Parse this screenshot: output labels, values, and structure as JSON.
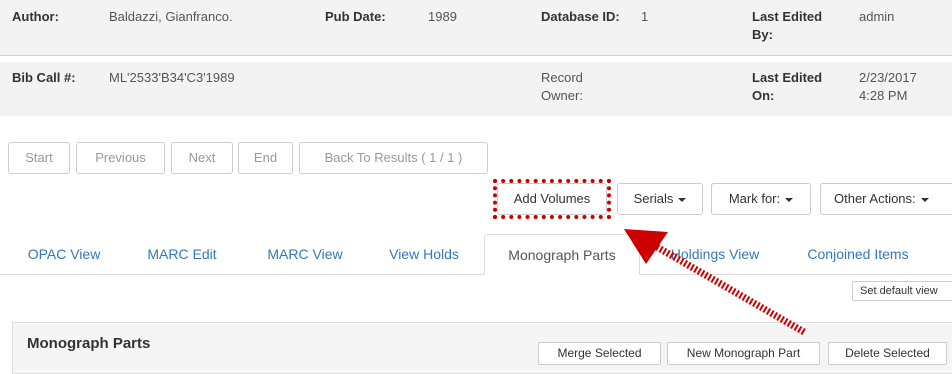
{
  "summary": {
    "author_label": "Author:",
    "author_value": "Baldazzi, Gianfranco.",
    "pubdate_label": "Pub Date:",
    "pubdate_value": "1989",
    "dbid_label": "Database ID:",
    "dbid_value": "1",
    "lastedited_by_label_line1": "Last Edited",
    "lastedited_by_label_line2": "By:",
    "lastedited_by_value": "admin",
    "bibcall_label": "Bib Call #:",
    "bibcall_value": "ML'2533'B34'C3'1989",
    "owner_label_line1": "Record",
    "owner_label_line2": "Owner:",
    "lastedited_on_label_line1": "Last Edited",
    "lastedited_on_label_line2": "On:",
    "lastedited_on_date": "2/23/2017",
    "lastedited_on_time": "4:28 PM"
  },
  "nav": {
    "start": "Start",
    "previous": "Previous",
    "next": "Next",
    "end": "End",
    "back": "Back To Results ( 1 / 1 )"
  },
  "actions": {
    "add_volumes": "Add Volumes",
    "serials": "Serials",
    "mark_for": "Mark for:",
    "other_actions": "Other Actions:"
  },
  "tabs": [
    {
      "label": "OPAC View"
    },
    {
      "label": "MARC Edit"
    },
    {
      "label": "MARC View"
    },
    {
      "label": "View Holds"
    },
    {
      "label": "Monograph Parts"
    },
    {
      "label": "Holdings View"
    },
    {
      "label": "Conjoined Items"
    }
  ],
  "set_default_view": "Set default view",
  "panel": {
    "title": "Monograph Parts",
    "merge_selected": "Merge Selected",
    "new_part": "New Monograph Part",
    "delete_selected": "Delete Selected"
  },
  "colors": {
    "link": "#337ab7",
    "highlight": "#cc0000",
    "summary_bg": "#f3f3f3"
  }
}
